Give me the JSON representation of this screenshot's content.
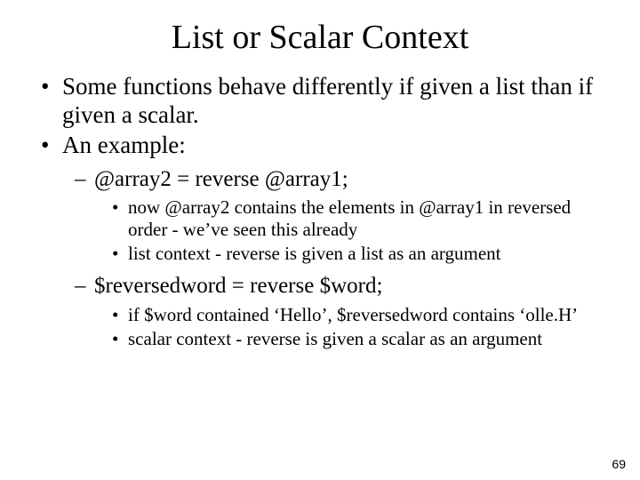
{
  "title": "List or Scalar Context",
  "bullets": {
    "b1": "Some functions behave differently if given a list than if given a scalar.",
    "b2": "An example:",
    "sub1": "@array2 = reverse @array1;",
    "sub1_d1": "now @array2 contains the elements in @array1 in reversed order - we’ve seen this already",
    "sub1_d2": "list context - reverse is given a list as an argument",
    "sub2": "$reversedword = reverse $word;",
    "sub2_d1": "if $word contained ‘Hello’, $reversedword contains ‘olle.H’",
    "sub2_d2": "scalar context - reverse is given a scalar as an argument"
  },
  "page_number": "69"
}
